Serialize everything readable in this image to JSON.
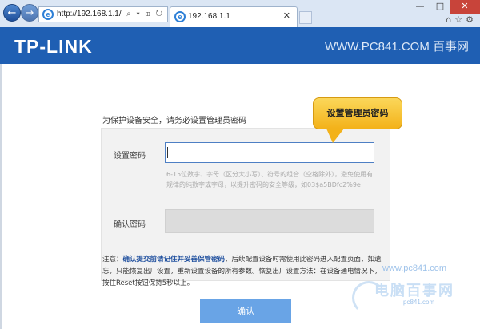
{
  "browser": {
    "back_glyph": "←",
    "forward_glyph": "→",
    "address": "http://192.168.1.1/",
    "address_tools": "⌕ ▾ ⊞ ↻",
    "tab_title": "192.168.1.1",
    "tab_close": "✕",
    "ie_glyph": "e",
    "win_min": "—",
    "win_max": "□",
    "win_close": "✕",
    "toolbar_icons": "⌂☆⚙",
    "accent_color": "#1f5fb3"
  },
  "header": {
    "logo": "TP-LINK",
    "watermark": "WWW.PC841.COM 百事网"
  },
  "content": {
    "intro": "为保护设备安全，请务必设置管理员密码",
    "tooltip": "设置管理员密码",
    "password_label": "设置密码",
    "password_value": "",
    "hint": "6-15位数字、字母（区分大小写）、符号的组合（空格除外），避免使用有规律的纯数字或字母，以提升密码的安全等级，如03$a5BDfc2%9e",
    "confirm_label": "确认密码",
    "confirm_value": "",
    "note_prefix": "注意：",
    "note_link": "确认提交前请记住并妥善保管密码",
    "note_rest": "，后续配置设备时需使用此密码进入配置页面，如遗忘，只能恢复出厂设置，重新设置设备的所有参数。恢复出厂设置方法：在设备通电情况下，按住Reset按钮保持5秒以上。",
    "confirm_button": "确认"
  },
  "watermark_bottom": {
    "url": "www.pc841.com",
    "text": "电脑百事网",
    "sub": "pc841.com"
  }
}
